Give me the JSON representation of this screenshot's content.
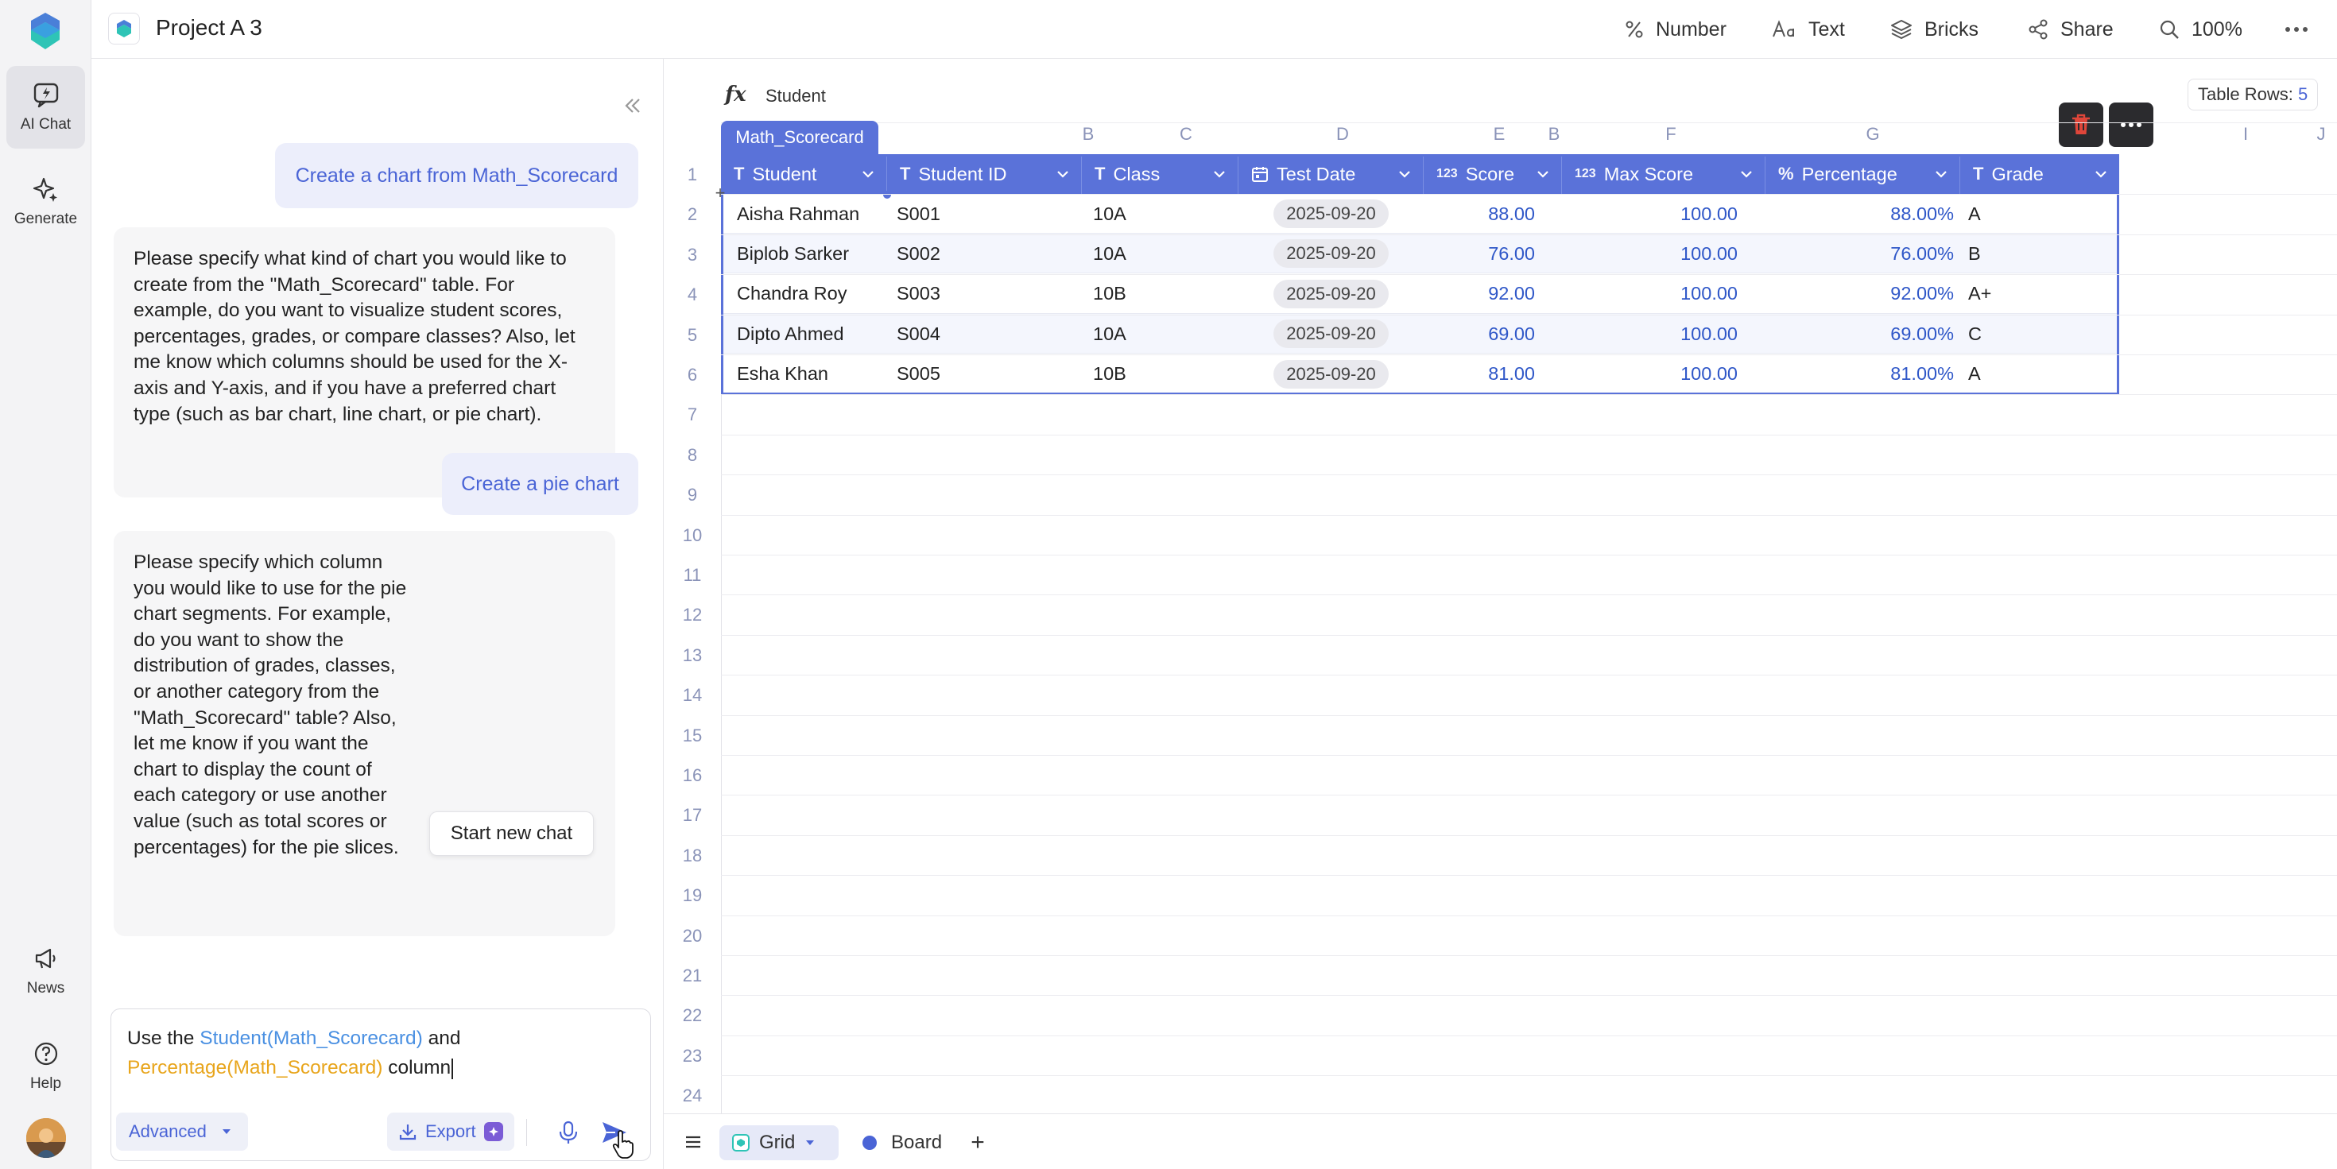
{
  "rail": {
    "items": [
      {
        "label": "AI Chat",
        "icon": "ai-chat-icon"
      },
      {
        "label": "Generate",
        "icon": "sparkle-icon"
      },
      {
        "label": "News",
        "icon": "megaphone-icon"
      },
      {
        "label": "Help",
        "icon": "help-icon"
      }
    ]
  },
  "header": {
    "project_title": "Project A 3",
    "buttons": {
      "number": "Number",
      "text": "Text",
      "bricks": "Bricks",
      "share": "Share",
      "zoom": "100%"
    }
  },
  "chat": {
    "messages": [
      {
        "role": "user",
        "text": "Create a chart from Math_Scorecard"
      },
      {
        "role": "assistant",
        "lines": [
          "Please specify what kind of chart you would like to",
          "create from the \"Math_Scorecard\" table. For",
          "example, do you want to visualize student scores,",
          "percentages, grades, or compare classes? Also, let",
          "me know which columns should be used for the X-",
          "axis and Y-axis, and if you have a preferred chart",
          "type (such as bar chart, line chart, or pie chart)."
        ]
      },
      {
        "role": "user",
        "text": "Create a pie chart"
      },
      {
        "role": "assistant",
        "lines": [
          "Please specify which column",
          "you would like to use for the pie",
          "chart segments. For example,",
          "do you want to show the",
          "distribution of grades, classes,",
          "or another category from the",
          "\"Math_Scorecard\" table? Also,",
          "let me know if you want the",
          "chart to display the count of",
          "each category or use another",
          "value (such as total scores or",
          "percentages) for the pie slices."
        ]
      }
    ],
    "start_new_chat": "Start new chat",
    "composer": {
      "prefix": "Use the ",
      "ref1": "Student(Math_Scorecard)",
      "mid": " and",
      "ref2": "Percentage(Math_Scorecard)",
      "suffix": " column",
      "advanced": "Advanced",
      "export": "Export"
    }
  },
  "sheet": {
    "formula_text": "Student",
    "table_rows_label": "Table Rows: ",
    "table_rows_count": "5",
    "table_name": "Math_Scorecard",
    "column_letters": [
      "B",
      "C",
      "D",
      "E",
      "F",
      "G",
      "I",
      "J"
    ],
    "columns": [
      {
        "type_icon": "T",
        "name": "Student"
      },
      {
        "type_icon": "T",
        "name": "Student ID"
      },
      {
        "type_icon": "T",
        "name": "Class"
      },
      {
        "type_icon": "date",
        "name": "Test Date"
      },
      {
        "type_icon": "123",
        "name": "Score"
      },
      {
        "type_icon": "123",
        "name": "Max Score"
      },
      {
        "type_icon": "%",
        "name": "Percentage"
      },
      {
        "type_icon": "T",
        "name": "Grade"
      }
    ],
    "rows": [
      [
        "Aisha Rahman",
        "S001",
        "10A",
        "2025-09-20",
        "88.00",
        "100.00",
        "88.00%",
        "A"
      ],
      [
        "Biplob Sarker",
        "S002",
        "10A",
        "2025-09-20",
        "76.00",
        "100.00",
        "76.00%",
        "B"
      ],
      [
        "Chandra Roy",
        "S003",
        "10B",
        "2025-09-20",
        "92.00",
        "100.00",
        "92.00%",
        "A+"
      ],
      [
        "Dipto Ahmed",
        "S004",
        "10A",
        "2025-09-20",
        "69.00",
        "100.00",
        "69.00%",
        "C"
      ],
      [
        "Esha Khan",
        "S005",
        "10B",
        "2025-09-20",
        "81.00",
        "100.00",
        "81.00%",
        "A"
      ]
    ],
    "row_numbers": [
      "1",
      "2",
      "3",
      "4",
      "5",
      "6",
      "7",
      "8",
      "9",
      "10",
      "11",
      "12",
      "13",
      "14",
      "15",
      "16",
      "17",
      "18",
      "19",
      "20",
      "21",
      "22",
      "23",
      "24"
    ]
  },
  "bottom": {
    "views": [
      {
        "label": "Grid"
      },
      {
        "label": "Board"
      }
    ]
  },
  "colors": {
    "accent": "#5a72d9",
    "danger": "#e0463a",
    "link_blue": "#4a90e2",
    "link_orange": "#e8a51c"
  }
}
